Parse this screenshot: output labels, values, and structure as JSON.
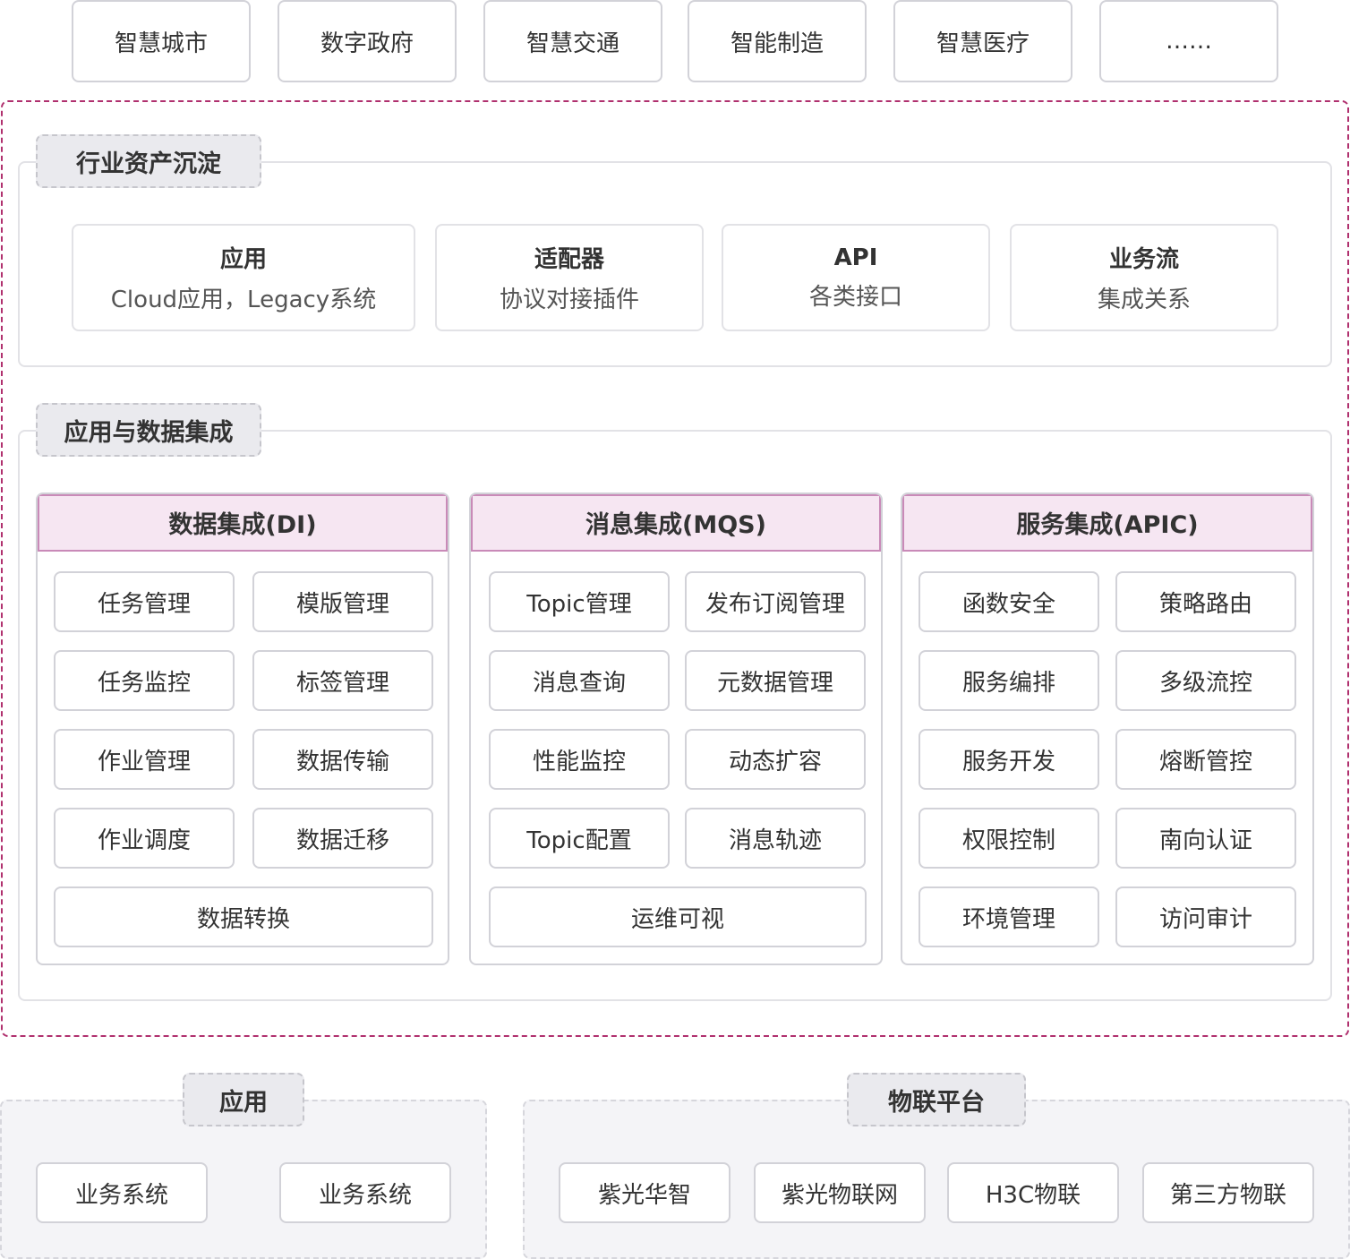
{
  "industries": [
    "智慧城市",
    "数字政府",
    "智慧交通",
    "智能制造",
    "智慧医疗",
    "……"
  ],
  "industry_assets": {
    "title": "行业资产沉淀",
    "cards": [
      {
        "title": "应用",
        "subtitle": "Cloud应用，Legacy系统"
      },
      {
        "title": "适配器",
        "subtitle": "协议对接插件"
      },
      {
        "title": "API",
        "subtitle": "各类接口"
      },
      {
        "title": "业务流",
        "subtitle": "集成关系"
      }
    ]
  },
  "integration": {
    "title": "应用与数据集成",
    "columns": [
      {
        "title": "数据集成(DI)",
        "items": [
          "任务管理",
          "模版管理",
          "任务监控",
          "标签管理",
          "作业管理",
          "数据传输",
          "作业调度",
          "数据迁移"
        ],
        "wide": "数据转换"
      },
      {
        "title": "消息集成(MQS)",
        "items": [
          "Topic管理",
          "发布订阅管理",
          "消息查询",
          "元数据管理",
          "性能监控",
          "动态扩容",
          "Topic配置",
          "消息轨迹"
        ],
        "wide": "运维可视"
      },
      {
        "title": "服务集成(APIC)",
        "items": [
          "函数安全",
          "策略路由",
          "服务编排",
          "多级流控",
          "服务开发",
          "熔断管控",
          "权限控制",
          "南向认证",
          "环境管理",
          "访问审计"
        ]
      }
    ]
  },
  "apps": {
    "title": "应用",
    "items": [
      "业务系统",
      "业务系统"
    ]
  },
  "iot": {
    "title": "物联平台",
    "items": [
      "紫光华智",
      "紫光物联网",
      "H3C物联",
      "第三方物联"
    ]
  },
  "colors": {
    "outer_dash": "#b0306e",
    "column_header_bg": "#f6e6f2",
    "column_header_border": "#c98ab8",
    "tag_bg": "#eaeaee"
  }
}
